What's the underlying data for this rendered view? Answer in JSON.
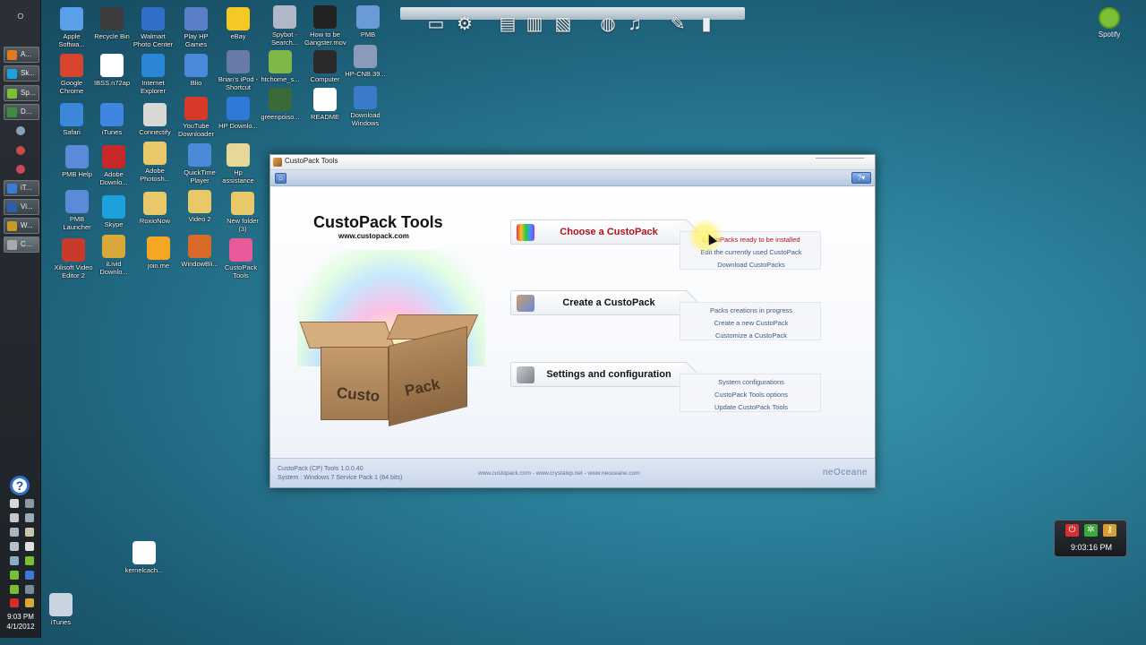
{
  "taskbar": {
    "items": [
      {
        "label": "A...",
        "color": "#e07a22"
      },
      {
        "label": "Sk...",
        "color": "#1da1dc"
      },
      {
        "label": "Sp...",
        "color": "#7cbf34"
      },
      {
        "label": "D...",
        "color": "#3c8e3c"
      },
      {
        "label": "iT...",
        "color": "#3a7dd8"
      },
      {
        "label": "Vi...",
        "color": "#2d5ea9"
      },
      {
        "label": "W...",
        "color": "#cc9a22"
      },
      {
        "label": "C...",
        "color": "#aaaaaa"
      }
    ],
    "clock_time": "9:03 PM",
    "clock_date": "4/1/2012"
  },
  "desktop_icons": [
    {
      "label": "Apple Softwa...",
      "color": "#5aa0e8"
    },
    {
      "label": "Recycle Bin",
      "color": "#3c3c3c"
    },
    {
      "label": "Walmart Photo Center",
      "color": "#2f6fc8"
    },
    {
      "label": "Play HP Games",
      "color": "#5a7fc8"
    },
    {
      "label": "eBay",
      "color": "#f5c823"
    },
    {
      "label": "Spybot - Search...",
      "color": "#b0b8c8"
    },
    {
      "label": "How to be Gangster.mov",
      "color": "#222222"
    },
    {
      "label": "PMB",
      "color": "#6a9ad8"
    },
    {
      "label": "Google Chrome",
      "color": "#d8452e"
    },
    {
      "label": "IBSS.n72ap",
      "color": "#ffffff"
    },
    {
      "label": "Internet Explorer",
      "color": "#2c86d8"
    },
    {
      "label": "Blio",
      "color": "#4a8ad8"
    },
    {
      "label": "Brian's iPod - Shortcut",
      "color": "#6a7aa8"
    },
    {
      "label": "htchome_s...",
      "color": "#7fb848"
    },
    {
      "label": "Computer",
      "color": "#2a2a2a"
    },
    {
      "label": "HP-CNB.39...",
      "color": "#8a9ab8"
    },
    {
      "label": "Safari",
      "color": "#3a88d8"
    },
    {
      "label": "iTunes",
      "color": "#3f86e0"
    },
    {
      "label": "Connectify",
      "color": "#d8d8d8"
    },
    {
      "label": "YouTube Downloader",
      "color": "#d83a2a"
    },
    {
      "label": "HP Downlo...",
      "color": "#2f7ad8"
    },
    {
      "label": "greenpoiso...",
      "color": "#3a6a3a"
    },
    {
      "label": "README",
      "color": "#ffffff"
    },
    {
      "label": "Download Windows",
      "color": "#3a7ac8"
    },
    {
      "label": "PMB Help",
      "color": "#5a8ad8"
    },
    {
      "label": "Adobe Downlo...",
      "color": "#c8282a"
    },
    {
      "label": "Adobe Photosh...",
      "color": "#e8c868"
    },
    {
      "label": "QuickTime Player",
      "color": "#4a8ad8"
    },
    {
      "label": "Hp assistance",
      "color": "#e8d898"
    },
    {
      "label": "PMB Launcher",
      "color": "#5a8ad8"
    },
    {
      "label": "Skype",
      "color": "#1da1dc"
    },
    {
      "label": "RoxioNow",
      "color": "#e8c868"
    },
    {
      "label": "Video 2",
      "color": "#e8c868"
    },
    {
      "label": "New folder (3)",
      "color": "#e8c868"
    },
    {
      "label": "Xilisoft Video Editor 2",
      "color": "#c83a2a"
    },
    {
      "label": "iLivid Downlo...",
      "color": "#d8a838"
    },
    {
      "label": "join.me",
      "color": "#f5a623"
    },
    {
      "label": "WindowBli...",
      "color": "#d86a2a"
    },
    {
      "label": "CustoPack Tools",
      "color": "#e85a9a"
    },
    {
      "label": "kernelcach...",
      "color": "#ffffff"
    },
    {
      "label": "iTunes",
      "color": "#c8d4e0"
    }
  ],
  "dock": {
    "icons": [
      "laptop-icon",
      "gear-icon",
      "folder-download-icon",
      "folder-icon",
      "folder-music-icon",
      "globe-icon",
      "music-icon",
      "wrench-icon",
      "trash-icon"
    ]
  },
  "spotify": {
    "label": "Spotify"
  },
  "gadget": {
    "time": "9:03:16 PM"
  },
  "window": {
    "title": "CustoPack Tools",
    "help_label": "?",
    "brand_title": "CustoPack Tools",
    "brand_url": "www.custopack.com",
    "box_text_1": "Custo",
    "box_text_2": "Pack",
    "menus": [
      {
        "label": "Choose a CustoPack",
        "active": true,
        "links": [
          "CustoPacks ready to be installed",
          "Edit the currently used CustoPack",
          "Download CustoPacks"
        ]
      },
      {
        "label": "Create a CustoPack",
        "active": false,
        "links": [
          "Packs creations in progress",
          "Create a new CustoPack",
          "Customize a CustoPack"
        ]
      },
      {
        "label": "Settings and configuration",
        "active": false,
        "links": [
          "System configurations",
          "CustoPack Tools options",
          "Update CustoPack Tools"
        ]
      }
    ],
    "footer": {
      "version": "CustoPack (CP) Tools 1.0.0.40",
      "system": "System : Windows 7 Service Pack 1 (64 bits)",
      "links": "www.custopack.com - www.crystalxp.net - www.neoceane.com",
      "logo": "neOceane"
    }
  }
}
